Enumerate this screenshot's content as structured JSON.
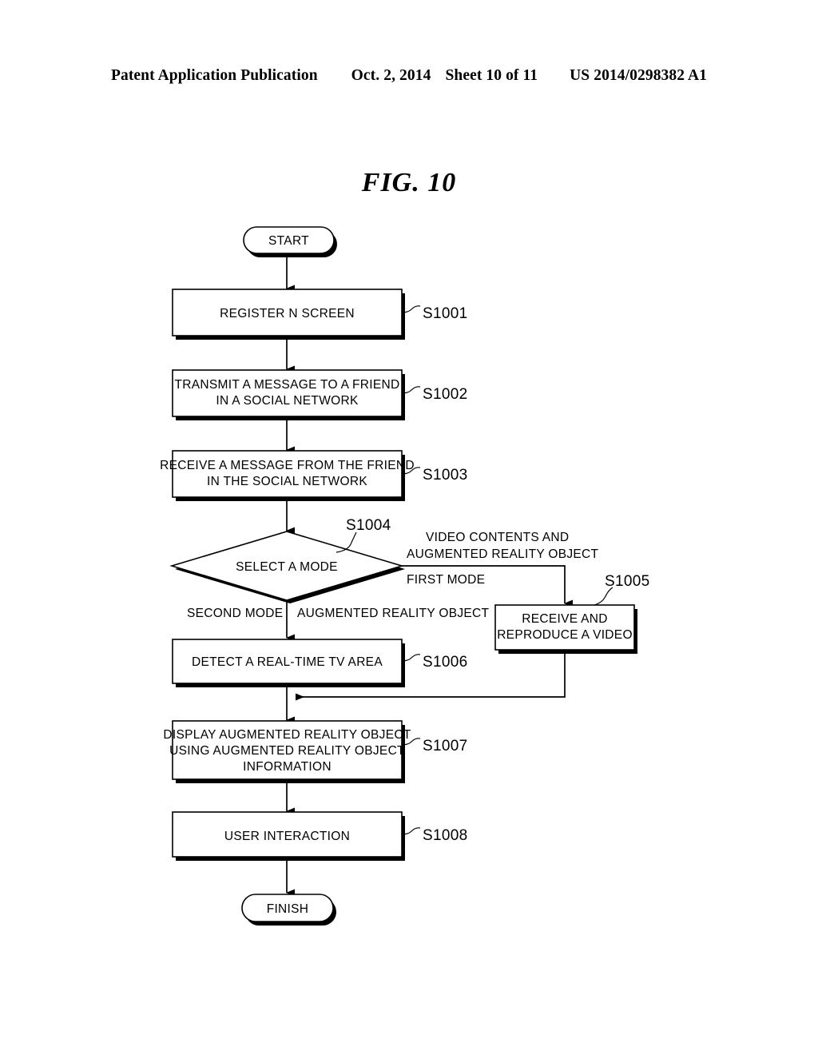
{
  "header": {
    "publication": "Patent Application Publication",
    "date": "Oct. 2, 2014",
    "sheet": "Sheet 10 of 11",
    "number": "US 2014/0298382 A1"
  },
  "figure": {
    "title": "FIG. 10"
  },
  "diagram": {
    "type": "flowchart",
    "nodes": [
      {
        "id": "start",
        "kind": "terminator",
        "lines": [
          "START"
        ],
        "ref": ""
      },
      {
        "id": "s1001",
        "kind": "process",
        "lines": [
          "REGISTER N SCREEN"
        ],
        "ref": "S1001"
      },
      {
        "id": "s1002",
        "kind": "process",
        "lines": [
          "TRANSMIT A MESSAGE TO A FRIEND",
          "IN A SOCIAL NETWORK"
        ],
        "ref": "S1002"
      },
      {
        "id": "s1003",
        "kind": "process",
        "lines": [
          "RECEIVE A MESSAGE FROM THE FRIEND",
          "IN THE SOCIAL NETWORK"
        ],
        "ref": "S1003"
      },
      {
        "id": "s1004",
        "kind": "decision",
        "lines": [
          "SELECT A MODE"
        ],
        "ref": "S1004"
      },
      {
        "id": "s1005",
        "kind": "process",
        "lines": [
          "RECEIVE AND",
          "REPRODUCE A VIDEO"
        ],
        "ref": "S1005"
      },
      {
        "id": "s1006",
        "kind": "process",
        "lines": [
          "DETECT A REAL-TIME TV AREA"
        ],
        "ref": "S1006"
      },
      {
        "id": "s1007",
        "kind": "process",
        "lines": [
          "DISPLAY AUGMENTED REALITY OBJECT",
          "USING AUGMENTED REALITY OBJECT",
          "INFORMATION"
        ],
        "ref": "S1007"
      },
      {
        "id": "s1008",
        "kind": "process",
        "lines": [
          "USER INTERACTION"
        ],
        "ref": "S1008"
      },
      {
        "id": "finish",
        "kind": "terminator",
        "lines": [
          "FINISH"
        ],
        "ref": ""
      }
    ],
    "edge_labels": {
      "first_mode": "FIRST MODE",
      "first_mode_payload_line1": "VIDEO CONTENTS AND",
      "first_mode_payload_line2": "AUGMENTED REALITY OBJECT",
      "second_mode": "SECOND MODE",
      "second_mode_payload": "AUGMENTED REALITY OBJECT"
    }
  },
  "colors": {
    "ink": "#000000",
    "paper": "#ffffff"
  }
}
